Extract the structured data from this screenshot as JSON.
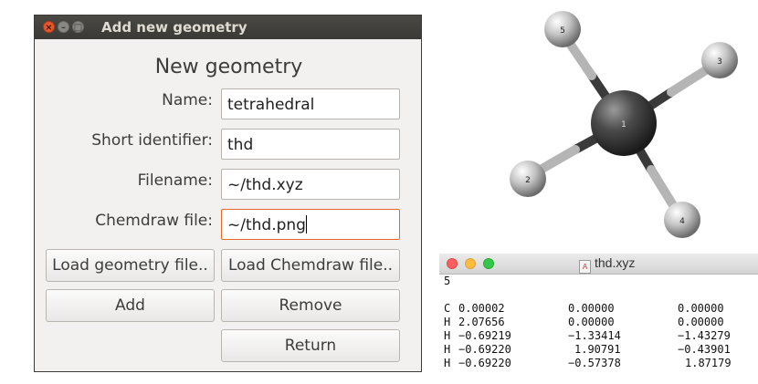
{
  "dialog": {
    "title": "Add new geometry",
    "heading": "New geometry",
    "fields": [
      {
        "label": "Name:",
        "value": "tetrahedral"
      },
      {
        "label": "Short identifier:",
        "value": "thd"
      },
      {
        "label": "Filename:",
        "value": "~/thd.xyz"
      },
      {
        "label": "Chemdraw file:",
        "value": "~/thd.png"
      }
    ],
    "buttons": {
      "load_geometry": "Load geometry file..",
      "load_chemdraw": "Load Chemdraw file..",
      "add": "Add",
      "remove": "Remove",
      "return": "Return"
    }
  },
  "molecule": {
    "atoms": [
      {
        "label": "1",
        "element": "C"
      },
      {
        "label": "2",
        "element": "H"
      },
      {
        "label": "3",
        "element": "H"
      },
      {
        "label": "4",
        "element": "H"
      },
      {
        "label": "5",
        "element": "H"
      }
    ]
  },
  "xyz_window": {
    "filename": "thd.xyz",
    "atom_count": "5",
    "rows": [
      {
        "el": "C",
        "x": "0.00002",
        "y": "0.00000",
        "z": "0.00000"
      },
      {
        "el": "H",
        "x": "2.07656",
        "y": "0.00000",
        "z": "0.00000"
      },
      {
        "el": "H",
        "x": "−0.69219",
        "y": "−1.33414",
        "z": "−1.43279"
      },
      {
        "el": "H",
        "x": "−0.69220",
        "y": "1.90791",
        "z": "−0.43901"
      },
      {
        "el": "H",
        "x": "−0.69220",
        "y": "−0.57378",
        "z": "1.87179"
      }
    ]
  },
  "colors": {
    "accent_focus": "#e9692c",
    "titlebar": "#3c3b37",
    "carbon": "#3d3d3d",
    "hydrogen": "#d9d9d9"
  }
}
